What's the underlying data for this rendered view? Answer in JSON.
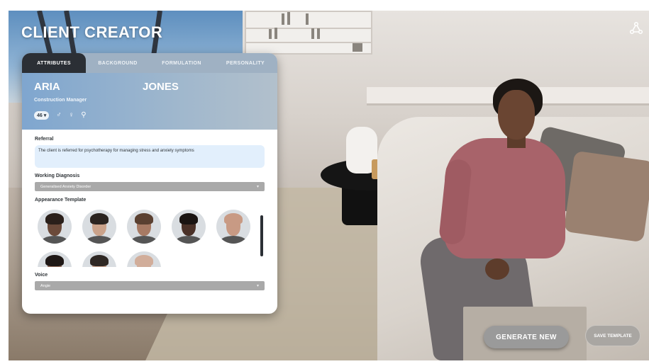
{
  "app": {
    "title": "CLIENT CREATOR",
    "corner_icon": "share-icon"
  },
  "tabs": [
    {
      "label": "ATTRIBUTES",
      "active": true
    },
    {
      "label": "BACKGROUND",
      "active": false
    },
    {
      "label": "FORMULATION",
      "active": false
    },
    {
      "label": "PERSONALITY",
      "active": false
    }
  ],
  "client": {
    "first_name": "ARIA",
    "last_name": "JONES",
    "occupation": "Construction Manager",
    "age": "46",
    "gender_icons": [
      "male-symbol-icon",
      "female-symbol-icon",
      "nonbinary-symbol-icon"
    ]
  },
  "referral": {
    "label": "Referral",
    "text": "The client is referred for psychotherapy for managing stress and anxiety symptoms"
  },
  "diagnosis": {
    "label": "Working Diagnosis",
    "value": "Generalised Anxiety Disorder"
  },
  "appearance": {
    "label": "Appearance Template",
    "templates": [
      {
        "name": "template-1",
        "skin": "#6b4a3a",
        "hair": "#2a1f1a"
      },
      {
        "name": "template-2",
        "skin": "#caa28a",
        "hair": "#2b2420"
      },
      {
        "name": "template-3",
        "skin": "#a77a64",
        "hair": "#5a4031"
      },
      {
        "name": "template-4",
        "skin": "#4a3128",
        "hair": "#1a1412"
      },
      {
        "name": "template-5",
        "skin": "#c89a84",
        "hair": "#c89a84"
      },
      {
        "name": "template-6",
        "skin": "#9b7462",
        "hair": "#1f1816"
      },
      {
        "name": "template-7",
        "skin": "#cfa893",
        "hair": "#2f2824"
      },
      {
        "name": "template-8",
        "skin": "#d1ad9a",
        "hair": "#d1ad9a"
      }
    ]
  },
  "voice": {
    "label": "Voice",
    "value": "Angie"
  },
  "actions": {
    "generate": "GENERATE NEW",
    "save": "SAVE TEMPLATE"
  },
  "colors": {
    "panel_header": "#9fb1c3",
    "active_tab": "#2b2f35",
    "referral_bg": "#e2effc"
  }
}
